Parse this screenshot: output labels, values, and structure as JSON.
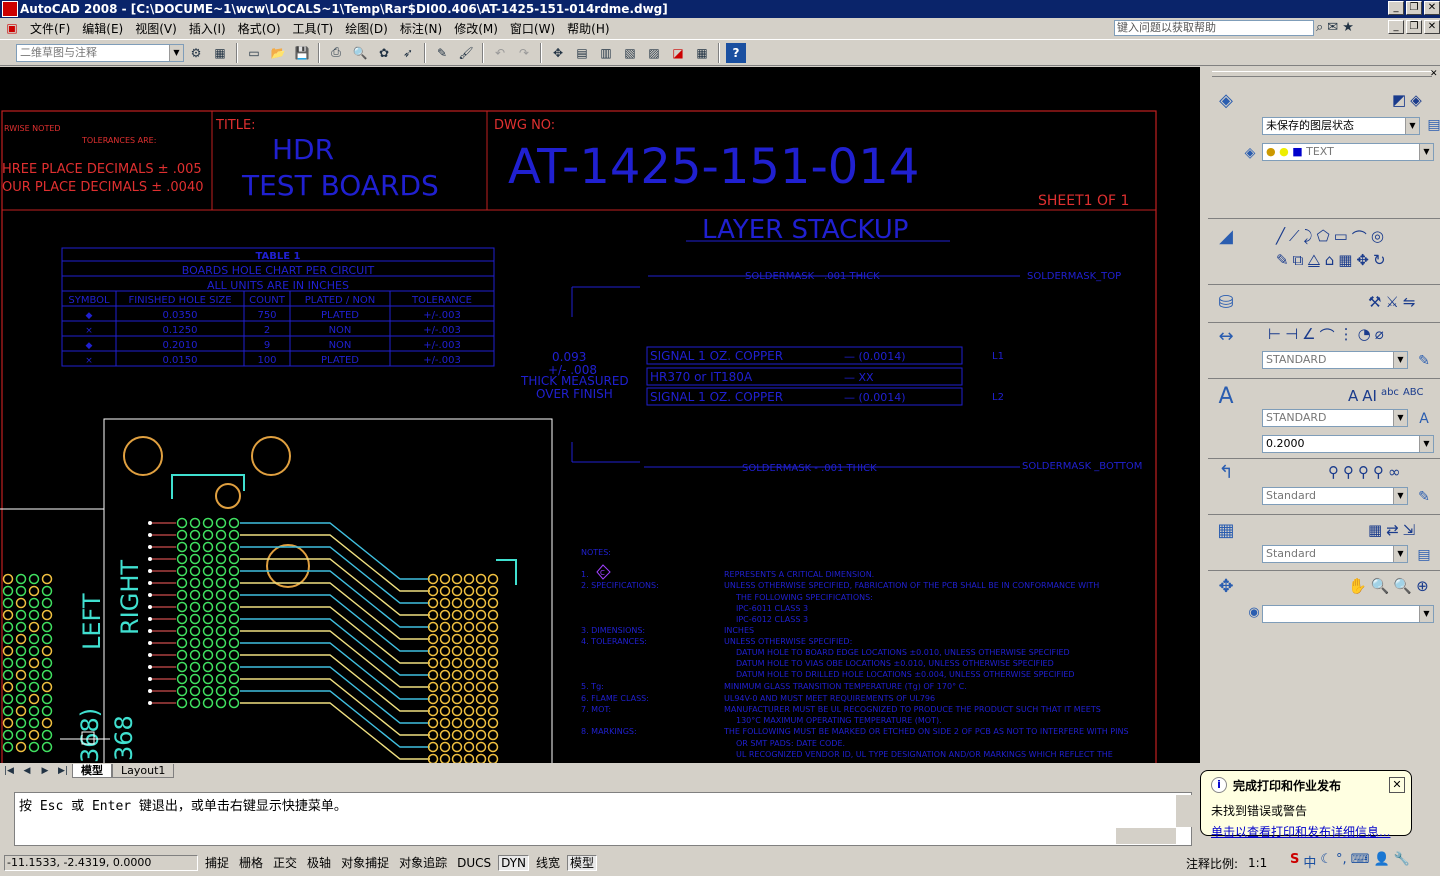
{
  "window": {
    "title": "AutoCAD 2008 - [C:\\DOCUME~1\\wcw\\LOCALS~1\\Temp\\Rar$DI00.406\\AT-1425-151-014rdme.dwg]"
  },
  "menu": [
    "文件(F)",
    "编辑(E)",
    "视图(V)",
    "插入(I)",
    "格式(O)",
    "工具(T)",
    "绘图(D)",
    "标注(N)",
    "修改(M)",
    "窗口(W)",
    "帮助(H)"
  ],
  "help_placeholder": "键入问题以获取帮助",
  "workspace": "二维草图与注释",
  "layers": {
    "state": "未保存的图层状态",
    "current": "TEXT"
  },
  "styles": {
    "dim": "STANDARD",
    "text": "STANDARD",
    "text_height": "0.2000",
    "mleader": "Standard",
    "table": "Standard"
  },
  "tabs": [
    "模型",
    "Layout1"
  ],
  "command": "按 Esc 或 Enter 键退出，或单击右键显示快捷菜单。",
  "status": {
    "coords": "-11.1533, -2.4319, 0.0000",
    "buttons": [
      "捕捉",
      "栅格",
      "正交",
      "极轴",
      "对象捕捉",
      "对象追踪",
      "DUCS",
      "DYN",
      "线宽",
      "模型"
    ],
    "scale_label": "注释比例:",
    "scale": "1:1"
  },
  "popup": {
    "title": "完成打印和作业发布",
    "line": "未找到错误或警告",
    "link": "单击以查看打印和发布详细信息..."
  },
  "drawing": {
    "tol_title1": "RWISE NOTED",
    "tol_title2": "TOLERANCES ARE:",
    "tol_three": "HREE PLACE DECIMALS ± .005",
    "tol_four": "OUR PLACE DECIMALS ± .0040",
    "title_label": "TITLE:",
    "title_line1": "HDR",
    "title_line2": "TEST BOARDS",
    "dwg_label": "DWG NO:",
    "dwg_no": "AT-1425-151-014",
    "sheet": "SHEET1 OF 1",
    "stackup_title": "LAYER STACKUP",
    "table": {
      "title": "TABLE 1",
      "sub1": "BOARDS HOLE CHART PER CIRCUIT",
      "sub2": "ALL UNITS ARE IN INCHES",
      "headers": [
        "SYMBOL",
        "FINISHED HOLE SIZE",
        "COUNT",
        "PLATED / NON",
        "TOLERANCE"
      ],
      "rows": [
        [
          "◆",
          "0.0350",
          "750",
          "PLATED",
          "+/-.003"
        ],
        [
          "×",
          "0.1250",
          "2",
          "NON",
          "+/-.003"
        ],
        [
          "◆",
          "0.2010",
          "9",
          "NON",
          "+/-.003"
        ],
        [
          "×",
          "0.0150",
          "100",
          "PLATED",
          "+/-.003"
        ]
      ]
    },
    "thickness1": "0.093",
    "thickness2": "+/- .008",
    "thickness3": "THICK MEASURED",
    "thickness4": "OVER FINISH",
    "soldermask_top_mid": "SOLDERMASK - .001 THICK",
    "soldermask_top_right": "SOLDERMASK_TOP",
    "soldermask_bot_mid": "SOLDERMASK - .001 THICK",
    "soldermask_bot_right": "SOLDERMASK _BOTTOM",
    "layer1": "SIGNAL 1 OZ. COPPER",
    "layer1_val": "— (0.0014)",
    "layer1_tag": "L1",
    "layer_core": "HR370 or IT180A",
    "layer_core_val": "— XX",
    "layer2": "SIGNAL 1 OZ. COPPER",
    "layer2_val": "— (0.0014)",
    "layer2_tag": "L2",
    "notes_title": "NOTES:",
    "note_c": "C",
    "notes_left": [
      "1.",
      "2. SPECIFICATIONS:",
      "3. DIMENSIONS:",
      "4. TOLERANCES:",
      "5. Tg:",
      "6. FLAME CLASS:",
      "7. MOT:",
      "8. MARKINGS:"
    ],
    "notes_right": [
      "REPRESENTS A CRITICAL DIMENSION.",
      "UNLESS OTHERWISE SPECIFIED, FABRICATION OF THE PCB SHALL BE IN CONFORMANCE WITH",
      "THE FOLLOWING SPECIFICATIONS:",
      "IPC-6011 CLASS 3",
      "IPC-6012 CLASS 3",
      "INCHES",
      "UNLESS OTHERWISE SPECIFIED:",
      "DATUM HOLE TO BOARD EDGE LOCATIONS ±0.010, UNLESS OTHERWISE SPECIFIED",
      "DATUM HOLE TO VIAS OBE LOCATIONS ±0.010, UNLESS OTHERWISE SPECIFIED",
      "DATUM HOLE TO DRILLED HOLE LOCATIONS ±0.004, UNLESS OTHERWISE SPECIFIED",
      "MINIMUM GLASS TRANSITION TEMPERATURE (Tg) OF 170° C.",
      "UL94V-0 AND MUST MEET REQUIREMENTS OF UL796",
      "MANUFACTURER MUST BE UL RECOGNIZED TO PRODUCE THE PRODUCT SUCH THAT IT MEETS",
      "130°C MAXIMUM OPERATING TEMPERATURE (MOT).",
      "THE FOLLOWING MUST BE MARKED OR ETCHED ON SIDE 2 OF PCB AS NOT TO INTERFERE WITH PINS",
      "OR SMT PADS: DATE CODE.",
      "UL RECOGNIZED VENDOR ID, UL TYPE DESIGNATION AND/OR MARKINGS WHICH REFLECT THE"
    ],
    "label_left": "LEFT",
    "label_right": "RIGHT",
    "label_368a": "368)",
    "label_368b": "368"
  }
}
